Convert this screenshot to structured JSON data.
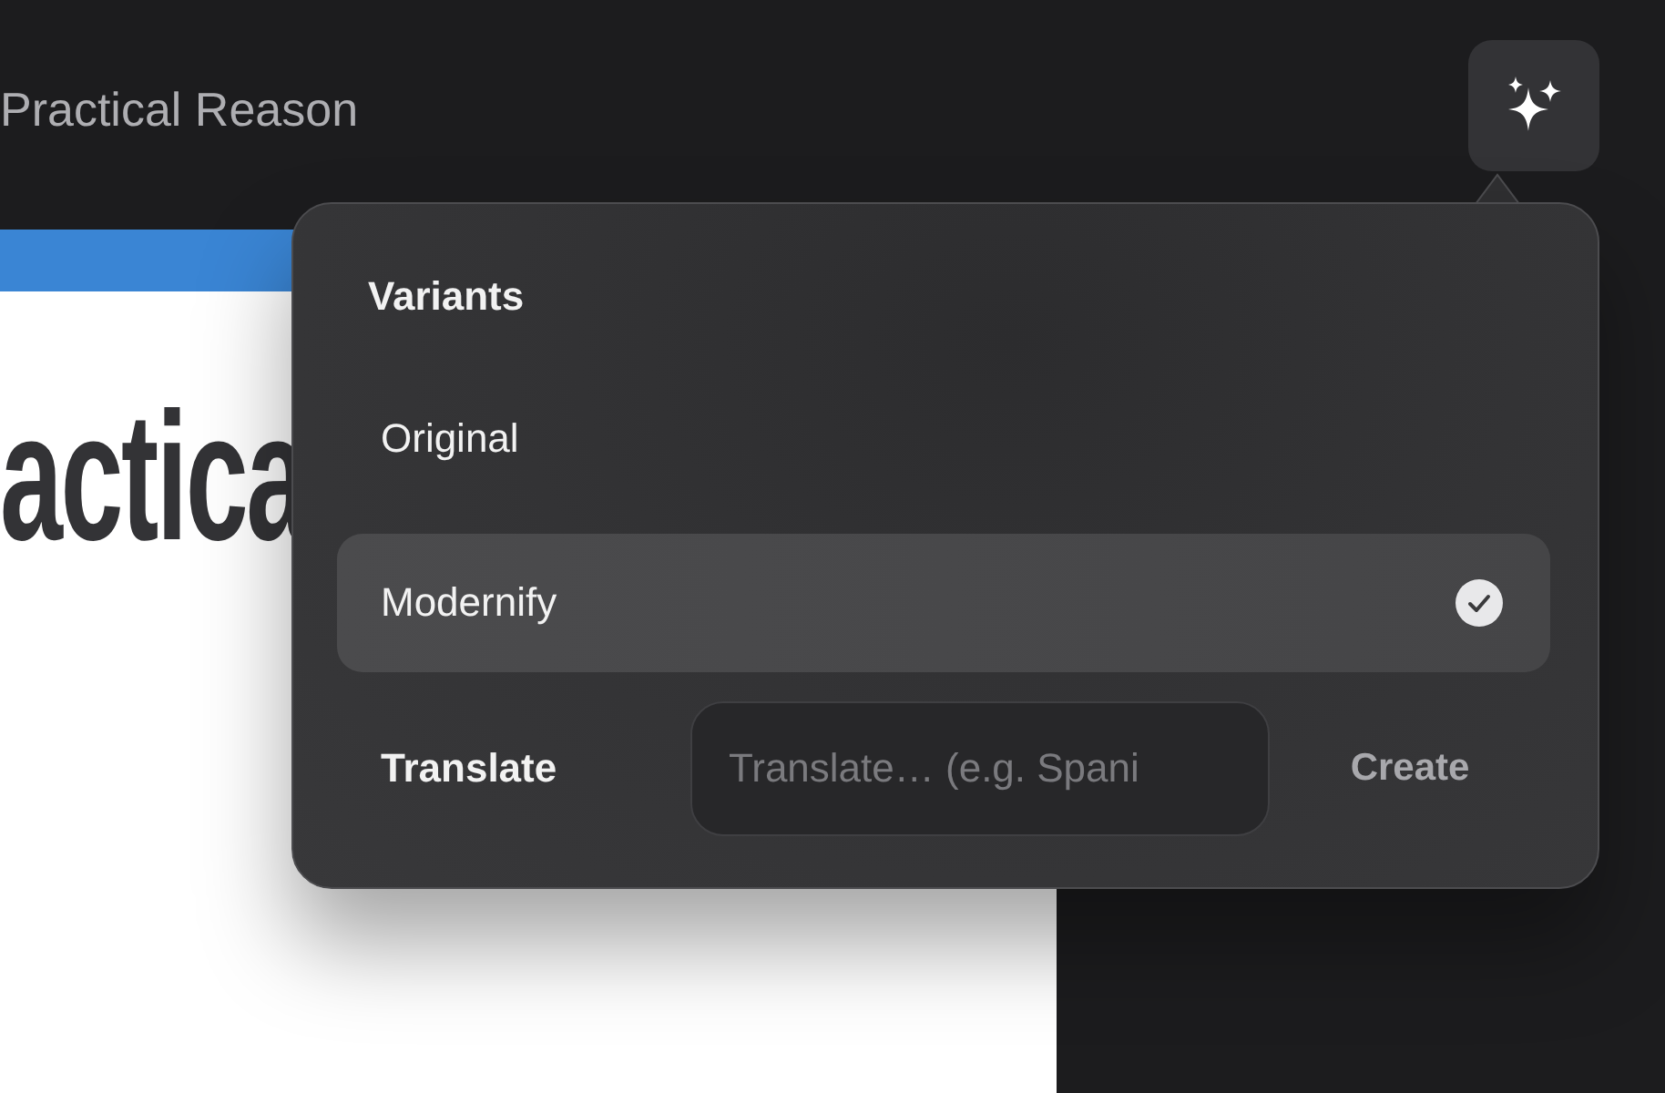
{
  "header": {
    "title": "Practical Reason"
  },
  "document": {
    "heading": "actica"
  },
  "popover": {
    "title": "Variants",
    "variants": [
      {
        "label": "Original",
        "selected": false
      },
      {
        "label": "Modernify",
        "selected": true
      }
    ],
    "translate": {
      "label": "Translate",
      "placeholder": "Translate… (e.g. Spani",
      "action": "Create"
    }
  }
}
